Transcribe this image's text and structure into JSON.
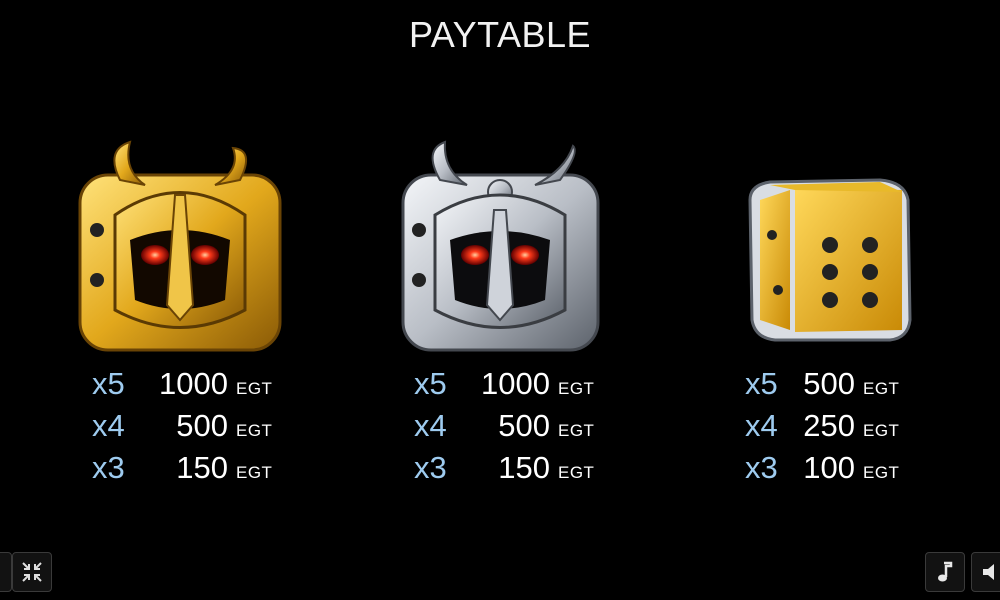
{
  "title": "PAYTABLE",
  "symbols": [
    {
      "icon": "gold-horned-helmet-icon",
      "pays": [
        {
          "mult": "x5",
          "amount": "1000",
          "currency": "EGT"
        },
        {
          "mult": "x4",
          "amount": "500",
          "currency": "EGT"
        },
        {
          "mult": "x3",
          "amount": "150",
          "currency": "EGT"
        }
      ]
    },
    {
      "icon": "silver-horned-helmet-icon",
      "pays": [
        {
          "mult": "x5",
          "amount": "1000",
          "currency": "EGT"
        },
        {
          "mult": "x4",
          "amount": "500",
          "currency": "EGT"
        },
        {
          "mult": "x3",
          "amount": "150",
          "currency": "EGT"
        }
      ]
    },
    {
      "icon": "gold-dice-icon",
      "pays": [
        {
          "mult": "x5",
          "amount": "500",
          "currency": "EGT"
        },
        {
          "mult": "x4",
          "amount": "250",
          "currency": "EGT"
        },
        {
          "mult": "x3",
          "amount": "100",
          "currency": "EGT"
        }
      ]
    }
  ],
  "controls": {
    "left_icon": "collapse-arrows-icon",
    "music_icon": "music-note-icon",
    "sound_icon": "speaker-icon"
  },
  "colors": {
    "background": "#000000",
    "multiplier": "#9ecbef",
    "value": "#ffffff",
    "gold": "#e2a81c",
    "silver": "#b9bec6"
  }
}
